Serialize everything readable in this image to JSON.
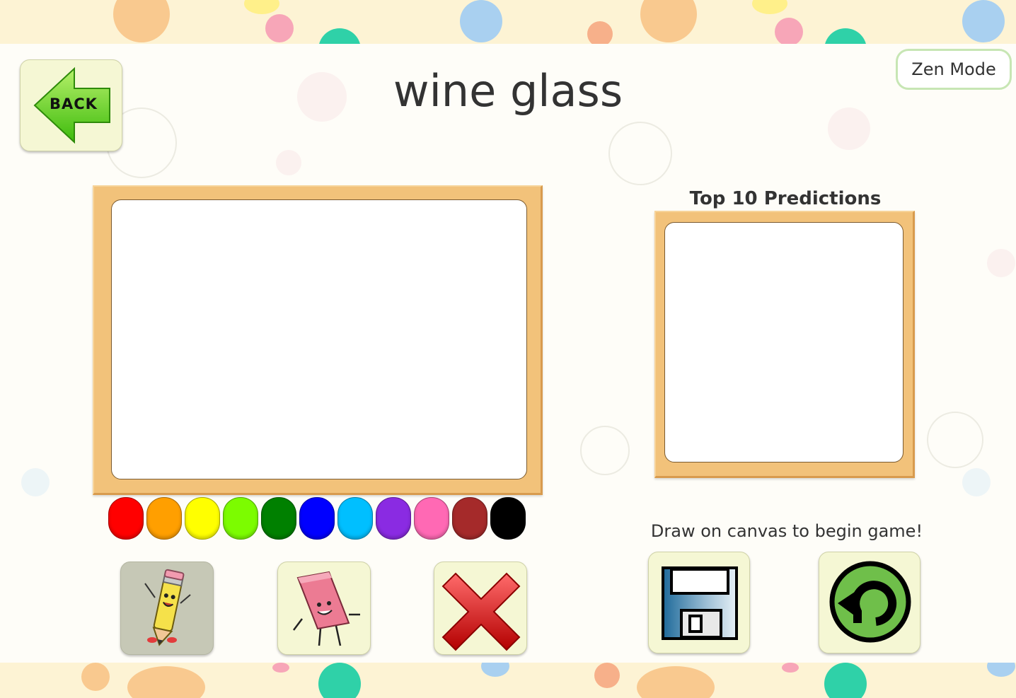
{
  "header": {
    "back_label": "BACK",
    "title": "wine glass",
    "zen_mode_label": "Zen Mode"
  },
  "predictions": {
    "title": "Top 10 Predictions",
    "items": []
  },
  "palette": {
    "colors": [
      "#ff0000",
      "#ff9f00",
      "#ffff00",
      "#7cfc00",
      "#008000",
      "#0000ff",
      "#00bfff",
      "#8a2be2",
      "#ff69b4",
      "#a52a2a",
      "#000000"
    ]
  },
  "tools": {
    "pencil": "pencil-icon",
    "eraser": "eraser-icon",
    "clear": "clear-x-icon",
    "save": "floppy-disk-icon",
    "undo": "undo-arrow-icon"
  },
  "status_text": "Draw on canvas to begin game!"
}
